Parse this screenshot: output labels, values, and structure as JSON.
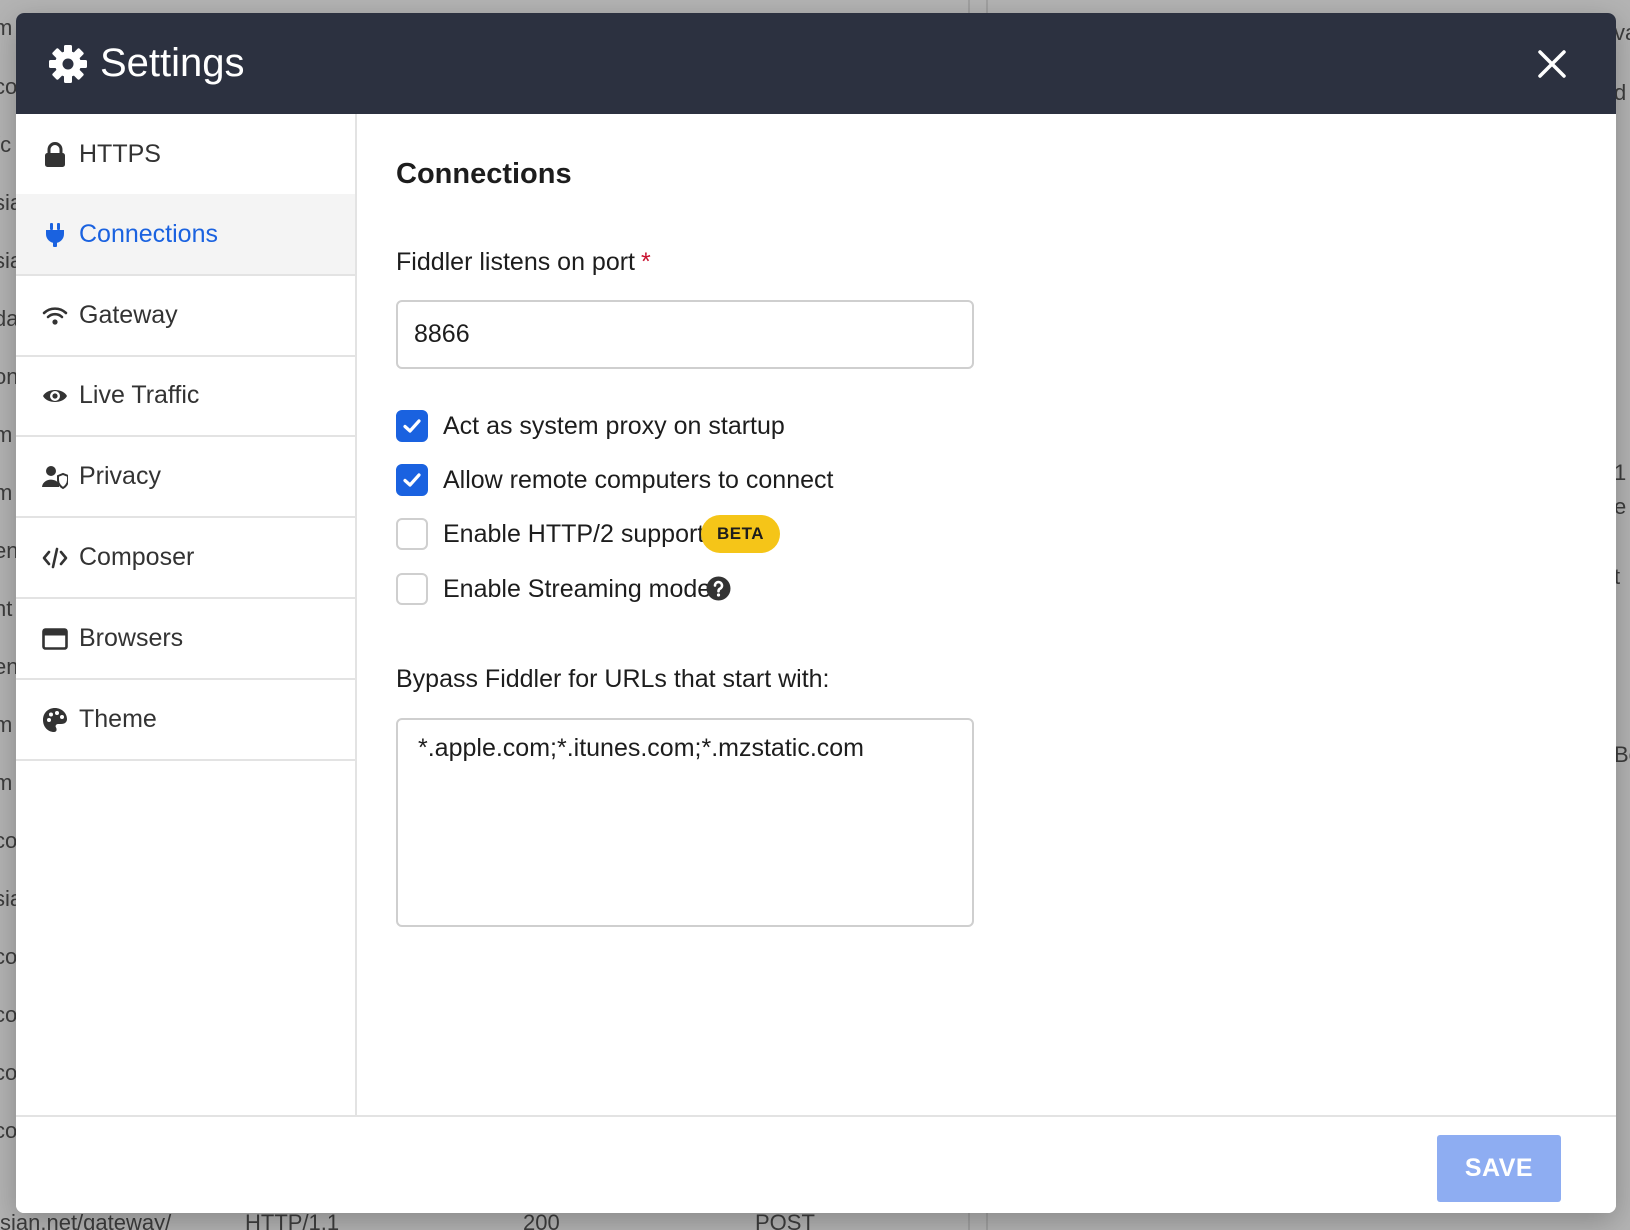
{
  "background": {
    "left_fragments": [
      "m",
      "co",
      "/c",
      "sia",
      "sia",
      "da",
      "on",
      "m",
      "m",
      "en",
      "nt",
      "en",
      "m",
      "m",
      "co",
      "sia",
      "co",
      "co",
      "co",
      "co"
    ],
    "right_fragments": [
      "va",
      "d",
      "1",
      "e",
      "t",
      "Bo"
    ],
    "bottom_row": {
      "url": "sian.net/gateway/",
      "protocol": "HTTP/1.1",
      "status": "200",
      "method": "POST"
    }
  },
  "modal": {
    "title": "Settings",
    "title_icon": "gear-icon",
    "close_icon": "close-icon",
    "header_color": "#2c3140"
  },
  "sidebar": {
    "items": [
      {
        "label": "HTTPS",
        "icon": "lock-icon",
        "active": false
      },
      {
        "label": "Connections",
        "icon": "plug-icon",
        "active": true
      },
      {
        "label": "Gateway",
        "icon": "wifi-icon",
        "active": false
      },
      {
        "label": "Live Traffic",
        "icon": "eye-icon",
        "active": false
      },
      {
        "label": "Privacy",
        "icon": "user-shield-icon",
        "active": false
      },
      {
        "label": "Composer",
        "icon": "code-icon",
        "active": false
      },
      {
        "label": "Browsers",
        "icon": "window-icon",
        "active": false
      },
      {
        "label": "Theme",
        "icon": "palette-icon",
        "active": false
      }
    ],
    "active_color": "#1a62e0"
  },
  "content": {
    "section_title": "Connections",
    "port": {
      "label": "Fiddler listens on port",
      "required_mark": "*",
      "value": "8866"
    },
    "options": [
      {
        "label": "Act as system proxy on startup",
        "checked": true
      },
      {
        "label": "Allow remote computers to connect",
        "checked": true
      },
      {
        "label": "Enable HTTP/2 support",
        "checked": false,
        "badge": "BETA"
      },
      {
        "label": "Enable Streaming mode",
        "checked": false,
        "help_icon": "question-circle-icon"
      }
    ],
    "bypass": {
      "label": "Bypass Fiddler for URLs that start with:",
      "value": "*.apple.com;*.itunes.com;*.mzstatic.com"
    }
  },
  "footer": {
    "save_label": "SAVE",
    "save_color": "#8eadf2"
  }
}
